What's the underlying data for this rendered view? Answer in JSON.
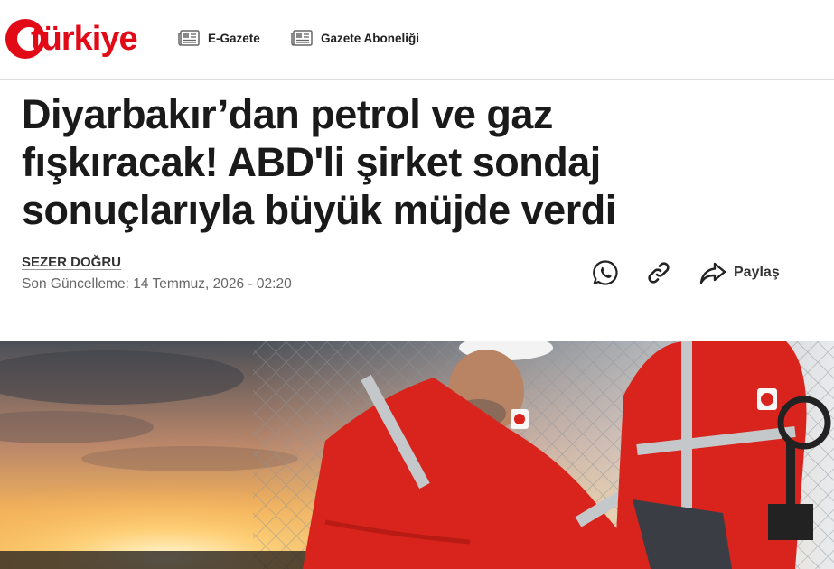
{
  "header": {
    "logo_text": "türkiye",
    "nav": [
      {
        "label": "E-Gazete",
        "icon": "newspaper-icon"
      },
      {
        "label": "Gazete Aboneliği",
        "icon": "newspaper-icon"
      }
    ]
  },
  "article": {
    "title": "Diyarbakır’dan petrol ve gaz fışkıracak! ABD'li şirket sondaj sonuçlarıyla büyük müjde verdi",
    "author": "SEZER DOĞRU",
    "updated": "Son Güncelleme: 14 Temmuz, 2026 - 02:20"
  },
  "share": {
    "whatsapp_icon": "whatsapp-icon",
    "link_icon": "link-icon",
    "share_label": "Paylaş"
  },
  "colors": {
    "brand": "#e30a17",
    "text": "#1a1a1a",
    "muted": "#666666"
  }
}
